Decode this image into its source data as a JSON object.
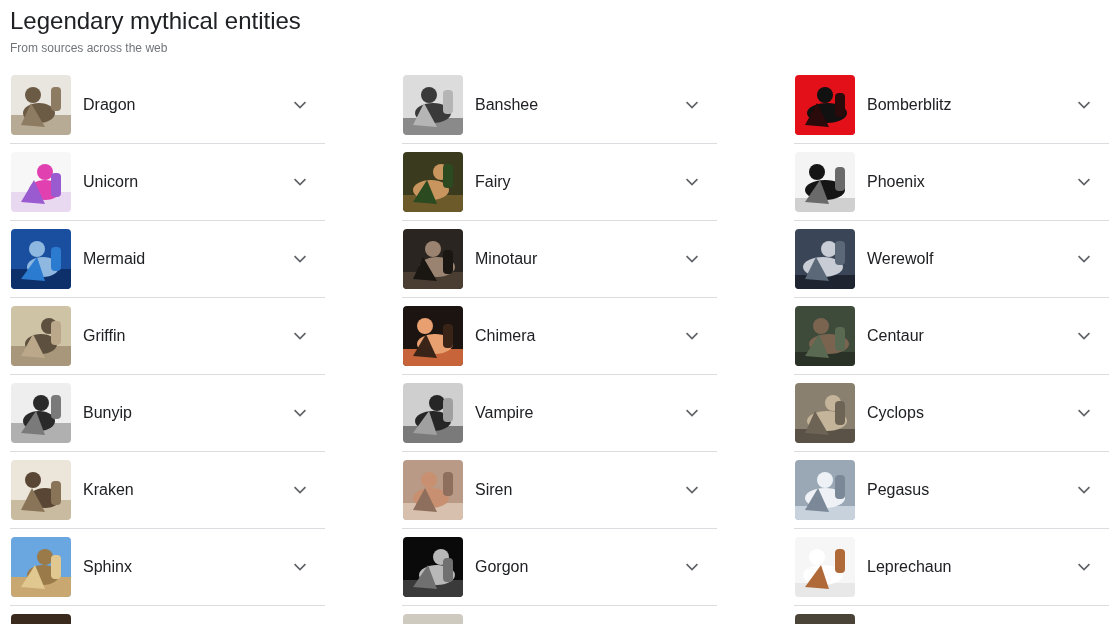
{
  "title": "Legendary mythical entities",
  "subtitle": "From sources across the web",
  "items": [
    {
      "name": "Dragon",
      "image": {
        "kind": "picture"
      }
    },
    {
      "name": "Banshee",
      "image": {
        "kind": "picture"
      }
    },
    {
      "name": "Bomberblitz",
      "image": {
        "kind": "picture"
      }
    },
    {
      "name": "Unicorn",
      "image": {
        "kind": "picture"
      }
    },
    {
      "name": "Fairy",
      "image": {
        "kind": "picture"
      }
    },
    {
      "name": "Phoenix",
      "image": {
        "kind": "picture"
      }
    },
    {
      "name": "Mermaid",
      "image": {
        "kind": "picture"
      }
    },
    {
      "name": "Minotaur",
      "image": {
        "kind": "picture"
      }
    },
    {
      "name": "Werewolf",
      "image": {
        "kind": "picture"
      }
    },
    {
      "name": "Griffin",
      "image": {
        "kind": "picture"
      }
    },
    {
      "name": "Chimera",
      "image": {
        "kind": "picture"
      }
    },
    {
      "name": "Centaur",
      "image": {
        "kind": "picture"
      }
    },
    {
      "name": "Bunyip",
      "image": {
        "kind": "picture"
      }
    },
    {
      "name": "Vampire",
      "image": {
        "kind": "picture"
      }
    },
    {
      "name": "Cyclops",
      "image": {
        "kind": "picture"
      }
    },
    {
      "name": "Kraken",
      "image": {
        "kind": "picture"
      }
    },
    {
      "name": "Siren",
      "image": {
        "kind": "picture"
      }
    },
    {
      "name": "Pegasus",
      "image": {
        "kind": "picture"
      }
    },
    {
      "name": "Sphinx",
      "image": {
        "kind": "picture"
      }
    },
    {
      "name": "Gorgon",
      "image": {
        "kind": "picture"
      }
    },
    {
      "name": "Leprechaun",
      "image": {
        "kind": "picture"
      }
    },
    {
      "image": {
        "kind": "picture"
      }
    },
    {
      "image": {
        "kind": "picture"
      }
    },
    {
      "image": {
        "kind": "picture"
      }
    }
  ]
}
